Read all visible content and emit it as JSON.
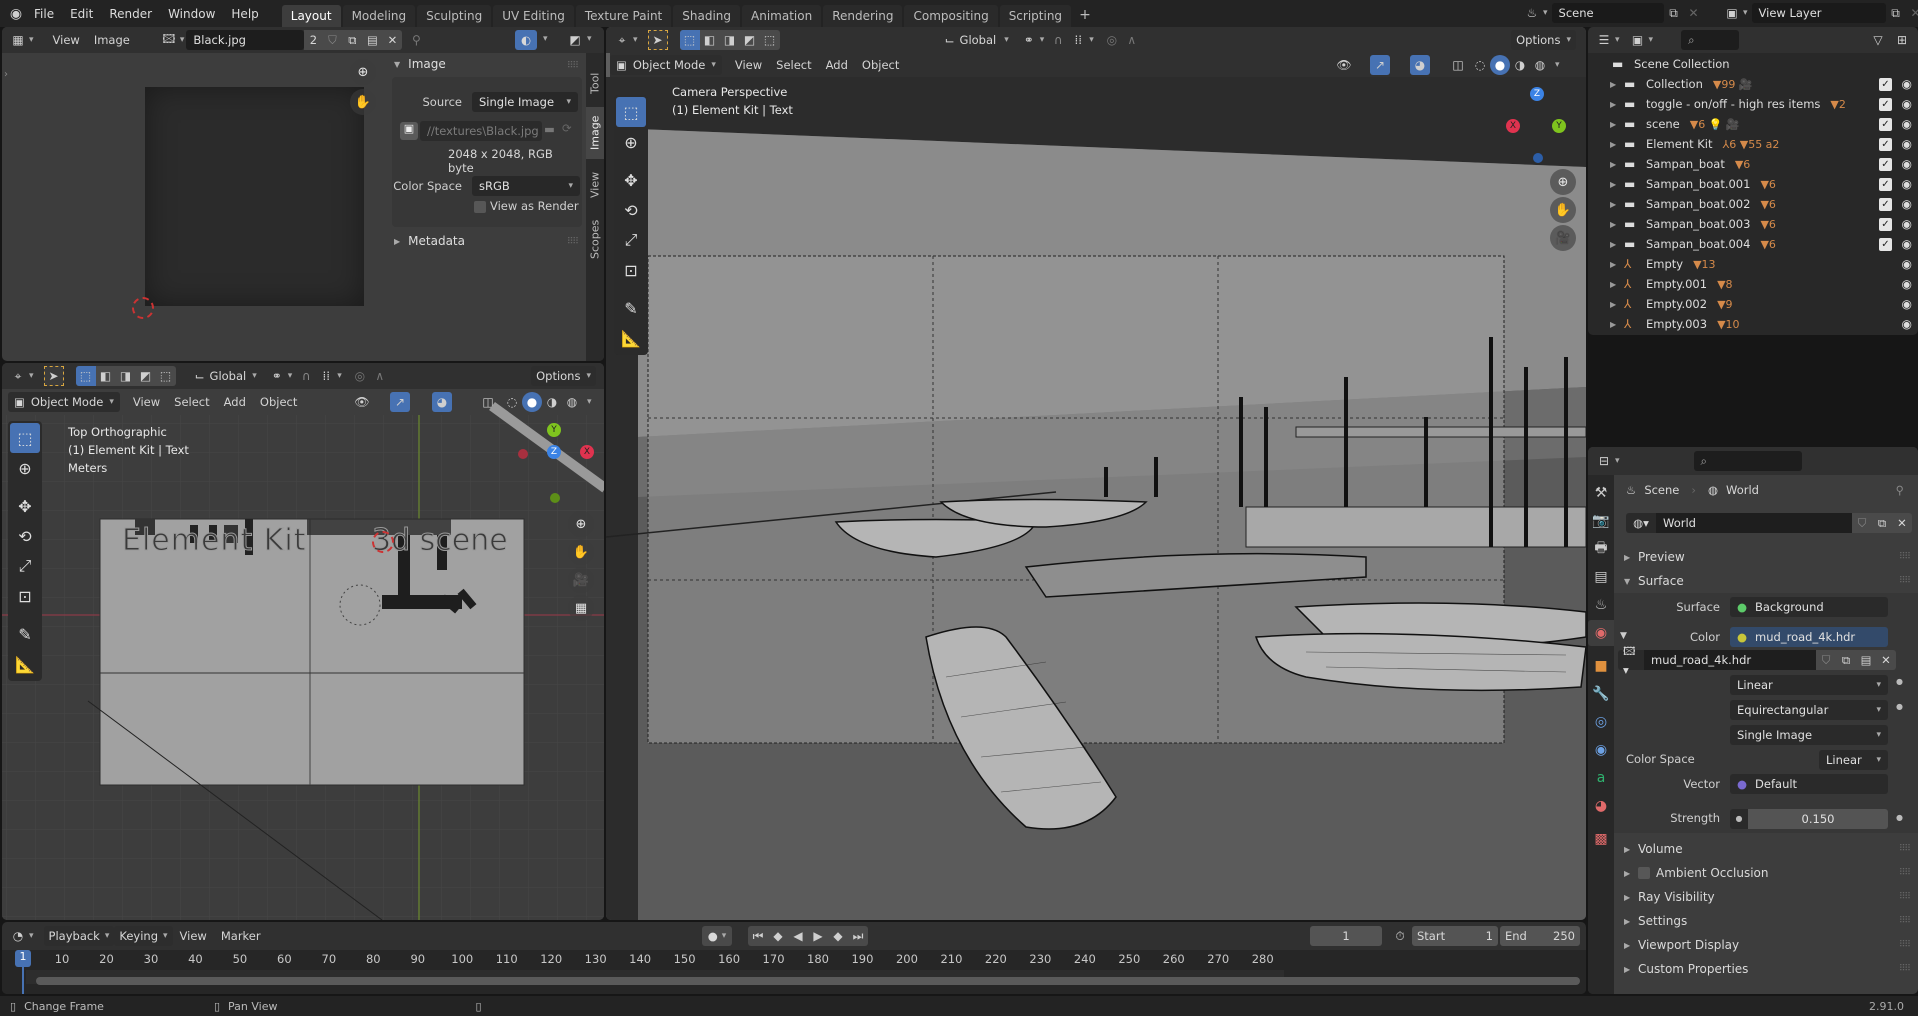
{
  "topbar": {
    "menus": [
      "File",
      "Edit",
      "Render",
      "Window",
      "Help"
    ],
    "workspaces": [
      "Layout",
      "Modeling",
      "Sculpting",
      "UV Editing",
      "Texture Paint",
      "Shading",
      "Animation",
      "Rendering",
      "Compositing",
      "Scripting"
    ],
    "active_workspace": "Layout",
    "add_tab": "+",
    "scene": "Scene",
    "view_layer": "View Layer"
  },
  "image_editor": {
    "menus": [
      "View",
      "Image"
    ],
    "image_name": "Black.jpg",
    "users": "2",
    "sidebar_tabs": [
      "Tool",
      "Image",
      "View",
      "Scopes"
    ],
    "panel": {
      "title": "Image",
      "source_label": "Source",
      "source_value": "Single Image",
      "filepath": "//textures\\Black.jpg",
      "info": "2048 x 2048,  RGB byte",
      "color_space_label": "Color Space",
      "color_space_value": "sRGB",
      "view_as_render": "View as Render",
      "metadata": "Metadata"
    }
  },
  "viewport_top": {
    "transform_orientation": "Global",
    "options": "Options",
    "mode": "Object Mode",
    "menus": [
      "View",
      "Select",
      "Add",
      "Object"
    ],
    "view_name": "Top Orthographic",
    "object_info": "(1) Element Kit | Text",
    "units": "Meters",
    "scene_text_1": "Element Kit",
    "scene_text_2": "3d scene",
    "gizmo": {
      "y": "Y",
      "z": "Z",
      "x": "X"
    }
  },
  "viewport_main": {
    "transform_orientation": "Global",
    "options": "Options",
    "mode": "Object Mode",
    "menus": [
      "View",
      "Select",
      "Add",
      "Object"
    ],
    "view_name": "Camera Perspective",
    "object_info": "(1) Element Kit | Text",
    "gizmo": {
      "z": "Z",
      "x": "X",
      "y": "Y"
    }
  },
  "outliner": {
    "search_placeholder": "",
    "root": "Scene Collection",
    "items": [
      {
        "name": "Collection",
        "type": "collection",
        "badges": "▼99 🎥",
        "checked": true
      },
      {
        "name": "toggle - on/off - high res items",
        "type": "collection",
        "badges": "▼2",
        "checked": true
      },
      {
        "name": "scene",
        "type": "collection",
        "badges": "▼6 💡 🎥",
        "checked": true
      },
      {
        "name": "Element Kit",
        "type": "collection",
        "badges": "⅄6 ▼55 a2",
        "checked": true
      },
      {
        "name": "Sampan_boat",
        "type": "collection",
        "badges": "▼6",
        "checked": true
      },
      {
        "name": "Sampan_boat.001",
        "type": "collection",
        "badges": "▼6",
        "checked": true
      },
      {
        "name": "Sampan_boat.002",
        "type": "collection",
        "badges": "▼6",
        "checked": true
      },
      {
        "name": "Sampan_boat.003",
        "type": "collection",
        "badges": "▼6",
        "checked": true
      },
      {
        "name": "Sampan_boat.004",
        "type": "collection",
        "badges": "▼6",
        "checked": true
      },
      {
        "name": "Empty",
        "type": "empty",
        "badges": "▼13",
        "checked": false
      },
      {
        "name": "Empty.001",
        "type": "empty",
        "badges": "▼8",
        "checked": false
      },
      {
        "name": "Empty.002",
        "type": "empty",
        "badges": "▼9",
        "checked": false
      },
      {
        "name": "Empty.003",
        "type": "empty",
        "badges": "▼10",
        "checked": false
      }
    ]
  },
  "properties": {
    "breadcrumb_scene": "Scene",
    "breadcrumb_world": "World",
    "world_name": "World",
    "sections": {
      "preview": "Preview",
      "surface": "Surface",
      "volume": "Volume",
      "ambient_occlusion": "Ambient Occlusion",
      "ray_visibility": "Ray Visibility",
      "settings": "Settings",
      "viewport_display": "Viewport Display",
      "custom_properties": "Custom Properties"
    },
    "surface_label": "Surface",
    "surface_value": "Background",
    "color_label": "Color",
    "color_value": "mud_road_4k.hdr",
    "image_name": "mud_road_4k.hdr",
    "interpolation": "Linear",
    "projection": "Equirectangular",
    "source": "Single Image",
    "color_space_label": "Color Space",
    "color_space_value": "Linear",
    "vector_label": "Vector",
    "vector_value": "Default",
    "strength_label": "Strength",
    "strength_value": "0.150"
  },
  "timeline": {
    "menus": [
      "Playback",
      "Keying",
      "View",
      "Marker"
    ],
    "current_frame": "1",
    "start_label": "Start",
    "start_value": "1",
    "end_label": "End",
    "end_value": "250",
    "ticks": [
      "1",
      "10",
      "20",
      "30",
      "40",
      "50",
      "60",
      "70",
      "80",
      "90",
      "100",
      "110",
      "120",
      "130",
      "140",
      "150",
      "160",
      "170",
      "180",
      "190",
      "200",
      "210",
      "220",
      "230",
      "240",
      "250",
      "260",
      "270",
      "280"
    ]
  },
  "statusbar": {
    "hint_1": "Change Frame",
    "hint_2": "Pan View",
    "version": "2.91.0"
  },
  "colors": {
    "accent": "#4772b3",
    "active_tool": "#4772b3",
    "object_orange": "#d58a4a",
    "axis_x": "#e0334f",
    "axis_y": "#7fc41e",
    "axis_z": "#3b83e5"
  }
}
